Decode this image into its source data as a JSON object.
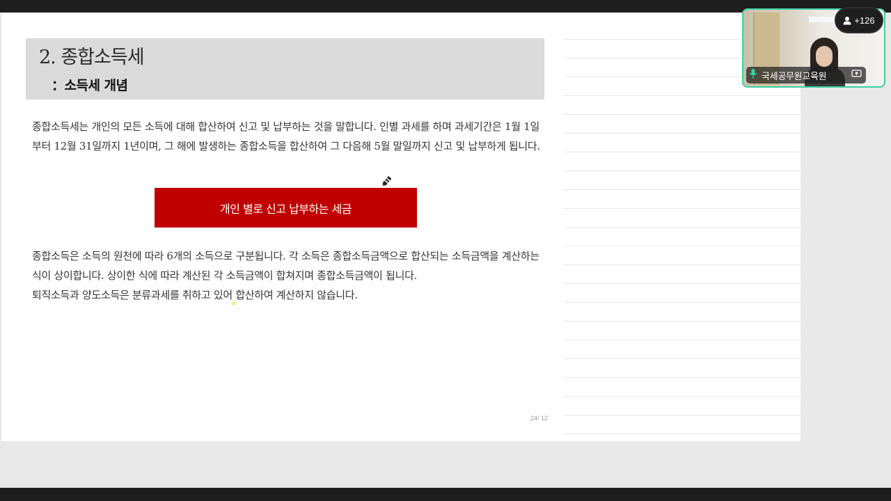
{
  "slide": {
    "title": "2. 종합소득세",
    "subtitle": "：소득세 개념",
    "paragraph1": "종합소득세는 개인의 모든 소득에 대해 합산하여 신고 및 납부하는 것을 말합니다. 인별 과세를 하며 과세기간은 1월 1일부터 12월 31일까지 1년이며, 그 해에 발생하는 종합소득을 합산하여 그 다음해 5월 말일까지 신고 및 납부하게 됩니다.",
    "banner": "개인 별로 신고 납부하는 세금",
    "paragraph2_line1": "종합소득은 소득의 원천에 따라 6개의 소득으로 구분됩니다. 각 소득은 종합소득금액으로 합산되는 소득금액을 계산하는 식이 상이합니다. 상이한 식에 따라 계산된 각 소득금액이 합쳐지며 종합소득금액이 됩니다.",
    "paragraph2_line2": "퇴직소득과 양도소득은 분류과세를 취하고 있어 합산하여 계산하지 않습니다.",
    "page_number": "24/ 12",
    "banner_color": "#c00000"
  },
  "video": {
    "participant_count": "+126",
    "speaker_name": "국세공무원교육원",
    "border_color": "#3ccfa3",
    "icons": [
      "person-icon",
      "mic-icon",
      "screen-share-icon"
    ]
  }
}
